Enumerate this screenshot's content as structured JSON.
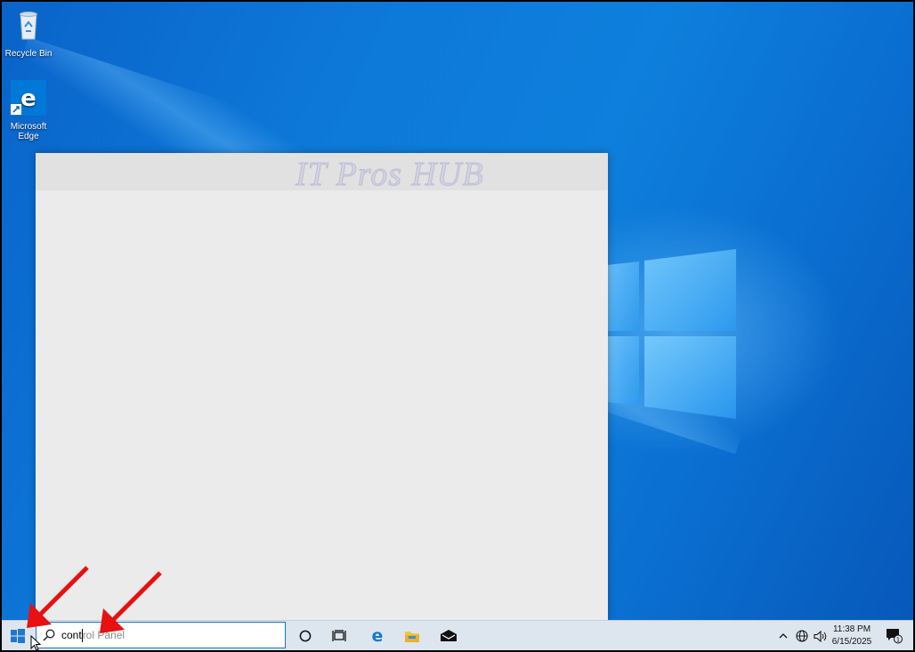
{
  "desktop": {
    "icons": [
      {
        "label": "Recycle Bin"
      },
      {
        "label": "Microsoft Edge"
      }
    ]
  },
  "watermark": "IT Pros HUB",
  "taskbar": {
    "search": {
      "typed": "cont",
      "suggestion_rest": "rol Panel"
    },
    "clock": {
      "time": "11:38 PM",
      "date": "6/15/2025"
    },
    "notification_count": "1"
  },
  "colors": {
    "accent": "#0078d7",
    "annotation_arrow": "#e81010",
    "taskbar": "#dde6ef"
  }
}
